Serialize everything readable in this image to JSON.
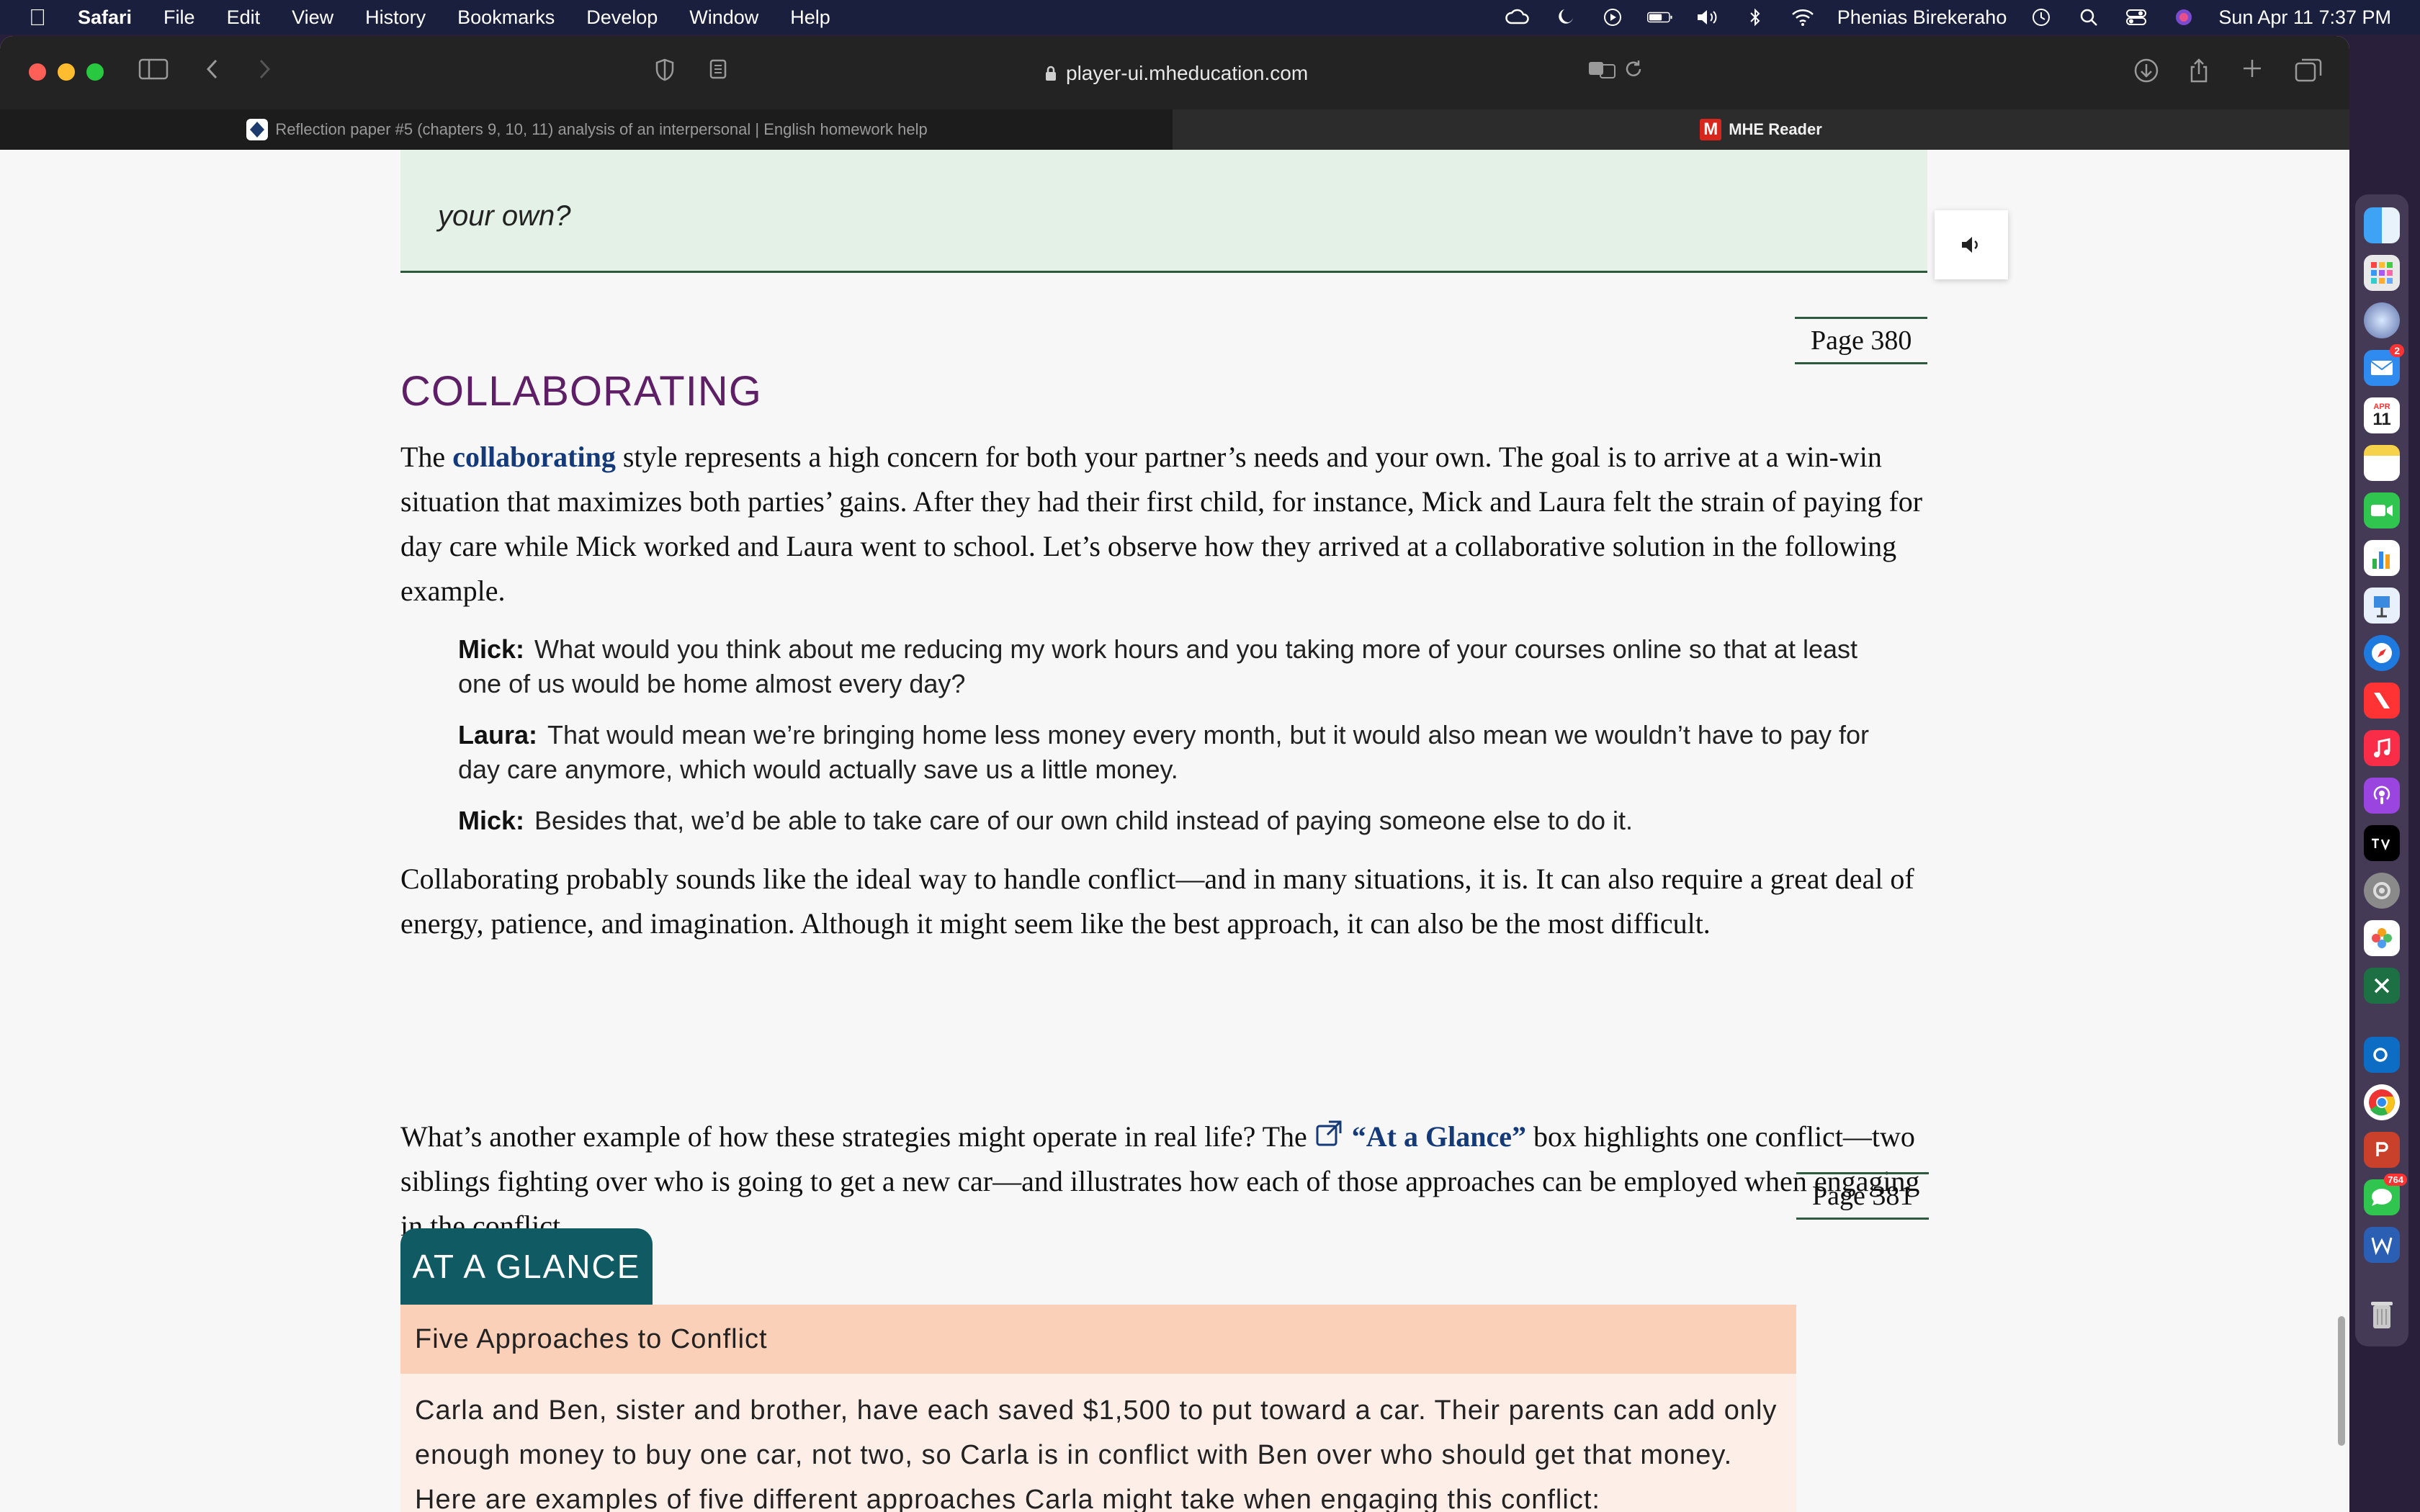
{
  "menubar": {
    "app": "Safari",
    "items": [
      "File",
      "Edit",
      "View",
      "History",
      "Bookmarks",
      "Develop",
      "Window",
      "Help"
    ],
    "user": "Phenias Birekeraho",
    "datetime": "Sun Apr 11  7:37 PM"
  },
  "toolbar": {
    "url": "player-ui.mheducation.com"
  },
  "tabs": [
    {
      "label": "Reflection paper #5 (chapters 9, 10, 11) analysis of an interpersonal | English homework help"
    },
    {
      "label": "MHE Reader"
    }
  ],
  "content": {
    "quote_tail": "your own?",
    "page380": "Page 380",
    "heading": "COLLABORATING",
    "para1_pre": "The ",
    "para1_kw": "collaborating",
    "para1_rest": " style represents a high concern for both your partner’s needs and your own. The goal is to arrive at a win-win situation that maximizes both parties’ gains. After they had their first child, for instance, Mick and Laura felt the strain of paying for day care while Mick worked and Laura went to school. Let’s observe how they arrived at a collaborative solution in the following example.",
    "dialogue": [
      {
        "speaker": "Mick:",
        "text": "What would you think about me reducing my work hours and you taking more of your courses online so that at least one of us would be home almost every day?"
      },
      {
        "speaker": "Laura:",
        "text": "That would mean we’re bringing home less money every month, but it would also mean we wouldn’t have to pay for day care anymore, which would actually save us a little money."
      },
      {
        "speaker": "Mick:",
        "text": "Besides that, we’d be able to take care of our own child instead of paying someone else to do it."
      }
    ],
    "para2": "Collaborating probably sounds like the ideal way to handle conflict—and in many situations, it is. It can also require a great deal of energy, patience, and imagination. Although it might seem like the best approach, it can also be the most difficult.",
    "para3_pre": "What’s another example of how these strategies might operate in real life? The ",
    "para3_link": "“At a Glance”",
    "para3_rest": " box highlights one conflict—two siblings fighting over who is going to get a new car—and illustrates how each of those approaches can be employed when engaging in the conflict.",
    "page381": "Page 381",
    "glance_tab": "AT A GLANCE",
    "glance_title": "Five Approaches to Conflict",
    "glance_body": "Carla and Ben, sister and brother, have each saved $1,500 to put toward a car. Their parents can add only enough money to buy one car, not two, so Carla is in conflict with Ben over who should get that money. Here are examples of five different approaches Carla might take when engaging this conflict:"
  },
  "dock": {
    "calendar_month": "APR",
    "calendar_day": "11",
    "mail_badge": "2",
    "messages_badge": "764"
  },
  "colors": {
    "heading": "#5e1f66",
    "keyword": "#143a7a",
    "glance_tab": "#0f5a63",
    "glance_head": "#fbd0b8"
  }
}
